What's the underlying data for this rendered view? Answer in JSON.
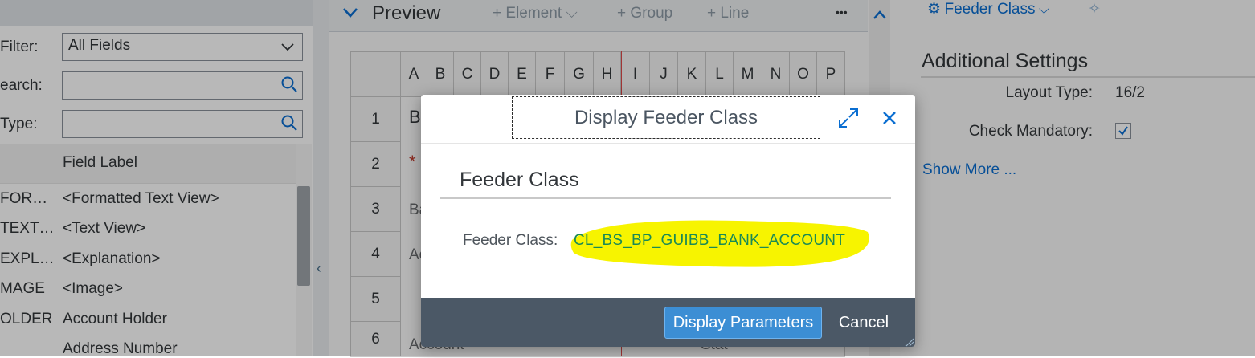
{
  "left": {
    "filter_label": "Filter:",
    "filter_value": "All Fields",
    "search_label": "earch:",
    "type_label": "Type:",
    "column_header": "Field Label",
    "rows": [
      {
        "id": "FOR…",
        "label": "<Formatted Text View>"
      },
      {
        "id": "TEXT…",
        "label": "<Text View>"
      },
      {
        "id": "EXPL…",
        "label": "<Explanation>"
      },
      {
        "id": "MAGE",
        "label": "<Image>"
      },
      {
        "id": "OLDER",
        "label": "Account Holder"
      },
      {
        "id": "",
        "label": "Address Number"
      }
    ]
  },
  "preview": {
    "title": "Preview",
    "toolbar": {
      "element": "Element",
      "group": "Group",
      "line": "Line",
      "overflow": "•••"
    },
    "columns": [
      "A",
      "B",
      "C",
      "D",
      "E",
      "F",
      "G",
      "H",
      "I",
      "J",
      "K",
      "L",
      "M",
      "N",
      "O",
      "P"
    ],
    "rows": [
      "1",
      "2",
      "3",
      "4",
      "5",
      "6"
    ],
    "partial_texts": {
      "r1": "B",
      "r2": "*",
      "r3": "Ba",
      "r4": "Ac",
      "r6": "Account",
      "r6b": "Stat"
    }
  },
  "right": {
    "header_label": "Feeder Class",
    "section_title": "Additional Settings",
    "layout_type_label": "Layout Type:",
    "layout_type_value": "16/2",
    "check_mandatory_label": "Check Mandatory:",
    "check_mandatory_checked": true,
    "show_more": "Show More ..."
  },
  "dialog": {
    "title": "Display Feeder Class",
    "section_title": "Feeder Class",
    "feeder_class_label": "Feeder Class:",
    "feeder_class_value": "CL_BS_BP_GUIBB_BANK_ACCOUNT",
    "primary_button": "Display Parameters",
    "cancel_button": "Cancel"
  },
  "colors": {
    "accent": "#0a6ed1",
    "dialog_footer": "#4b5866",
    "primary_button": "#3c8ed4",
    "highlight": "#f7f400",
    "value_text": "#1a8a55"
  }
}
